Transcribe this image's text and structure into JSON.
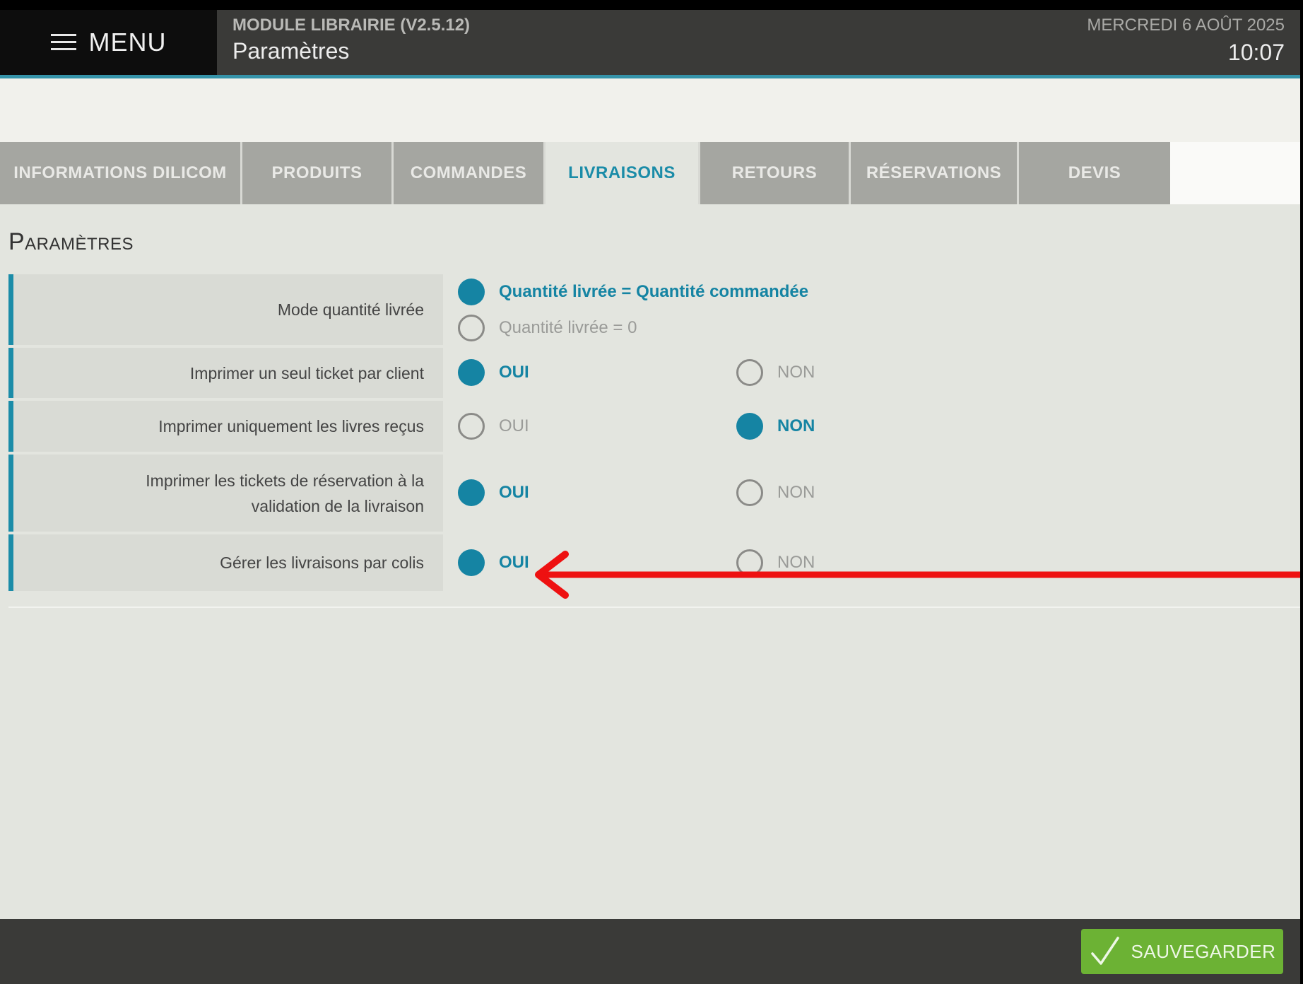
{
  "header": {
    "menu_label": "MENU",
    "module_title": "MODULE LIBRAIRIE (V2.5.12)",
    "page_title": "Paramètres",
    "date": "MERCREDI 6 AOÛT 2025",
    "time": "10:07"
  },
  "tabs": [
    {
      "label": "INFORMATIONS DILICOM",
      "active": false
    },
    {
      "label": "PRODUITS",
      "active": false
    },
    {
      "label": "COMMANDES",
      "active": false
    },
    {
      "label": "LIVRAISONS",
      "active": true
    },
    {
      "label": "RETOURS",
      "active": false
    },
    {
      "label": "RÉSERVATIONS",
      "active": false
    },
    {
      "label": "DEVIS",
      "active": false
    }
  ],
  "section_title": "Paramètres",
  "settings": [
    {
      "label": "Mode quantité livrée",
      "options": [
        "Quantité livrée = Quantité commandée",
        "Quantité livrée = 0"
      ],
      "selected": 0
    },
    {
      "label": "Imprimer un seul ticket par client",
      "options": [
        "OUI",
        "NON"
      ],
      "selected": 0
    },
    {
      "label": "Imprimer uniquement les livres reçus",
      "options": [
        "OUI",
        "NON"
      ],
      "selected": 1
    },
    {
      "label": "Imprimer les tickets de réservation à la validation de la livraison",
      "options": [
        "OUI",
        "NON"
      ],
      "selected": 0
    },
    {
      "label": "Gérer les livraisons par colis",
      "options": [
        "OUI",
        "NON"
      ],
      "selected": 0
    }
  ],
  "footer": {
    "save_label": "SAUVEGARDER"
  },
  "colors": {
    "accent": "#1584a3",
    "save": "#6cb234",
    "annotation": "#ee1111"
  },
  "icons": {
    "menu": "hamburger-icon",
    "save": "checkmark-icon",
    "annotation": "arrow-left-icon"
  }
}
